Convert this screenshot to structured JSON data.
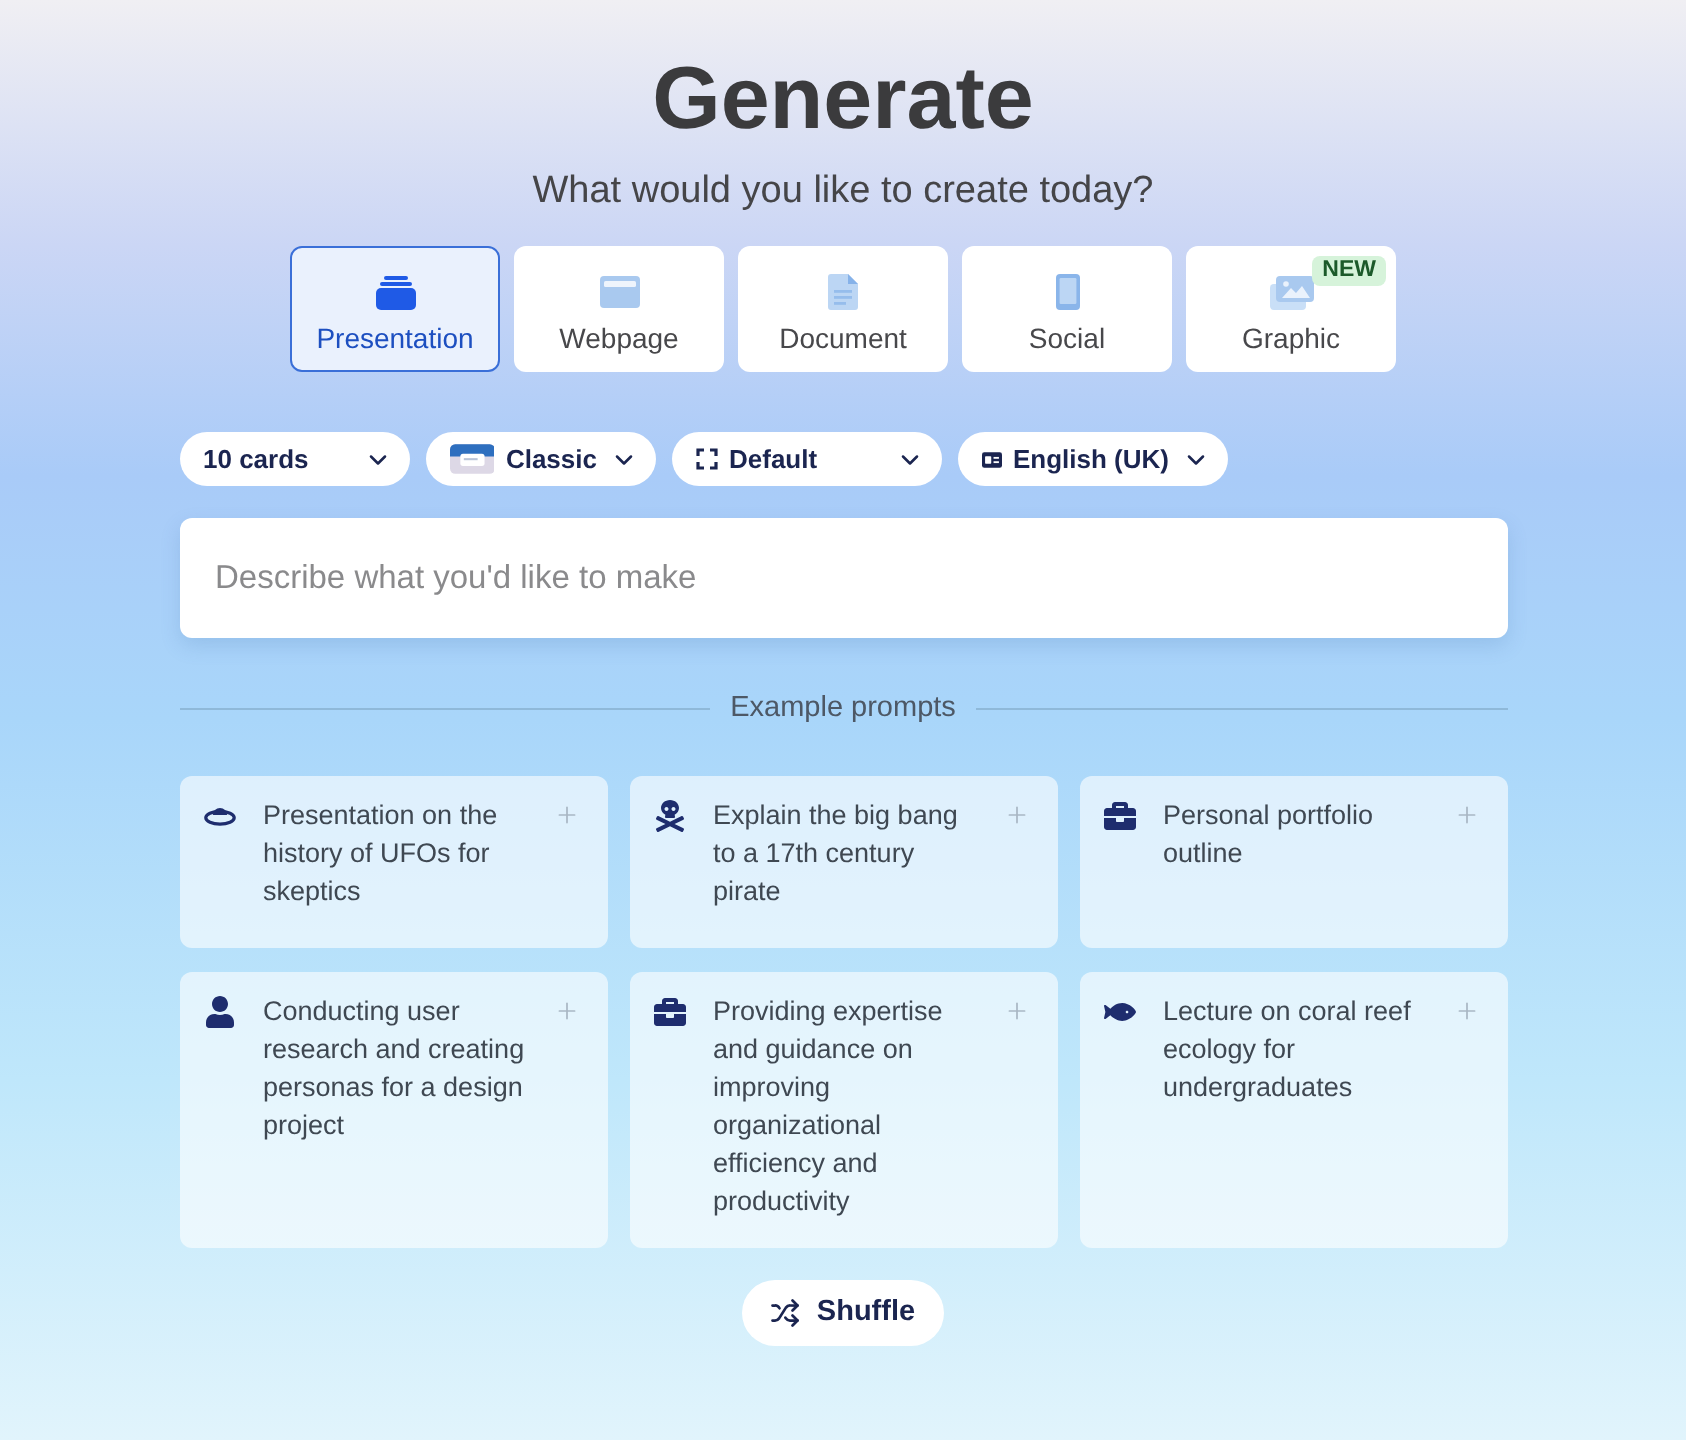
{
  "header": {
    "title": "Generate",
    "subtitle": "What would you like to create today?"
  },
  "content_types": [
    {
      "label": "Presentation",
      "selected": true
    },
    {
      "label": "Webpage",
      "selected": false
    },
    {
      "label": "Document",
      "selected": false
    },
    {
      "label": "Social",
      "selected": false
    },
    {
      "label": "Graphic",
      "selected": false,
      "badge": "NEW"
    }
  ],
  "options": [
    {
      "label": "10 cards"
    },
    {
      "label": "Classic"
    },
    {
      "label": "Default"
    },
    {
      "label": "English (UK)"
    }
  ],
  "prompt_input": {
    "placeholder": "Describe what you'd like to make"
  },
  "examples": {
    "heading": "Example prompts",
    "prompts": [
      {
        "text": "Presentation on the history of UFOs for skeptics"
      },
      {
        "text": "Explain the big bang to a 17th century pirate"
      },
      {
        "text": "Personal portfolio outline"
      },
      {
        "text": "Conducting user research and creating personas for a design project"
      },
      {
        "text": "Providing expertise and guidance on improving organizational efficiency and productivity"
      },
      {
        "text": "Lecture on coral reef ecology for undergraduates"
      }
    ]
  },
  "shuffle_button": {
    "label": "Shuffle"
  }
}
